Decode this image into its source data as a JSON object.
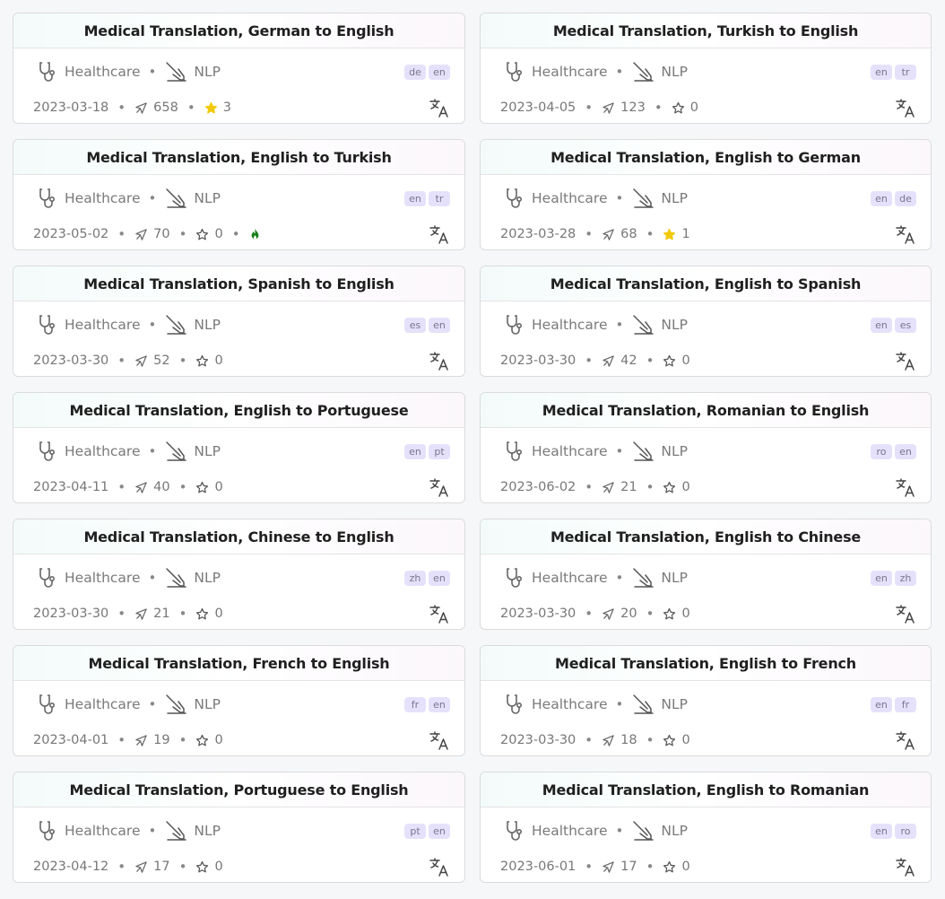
{
  "colors": {
    "star_filled": "#f2c90a",
    "flame": "#1a7f1a",
    "lang_badge_bg": "#e6e1fa",
    "lang_badge_fg": "#7a7690"
  },
  "icons": {
    "category": "stethoscope-icon",
    "type": "cpu-icon",
    "downloads": "pin-icon",
    "stars": "star-icon",
    "trending": "flame-icon",
    "task": "translate-icon"
  },
  "cards": [
    {
      "title": "Medical Translation, German to English",
      "category": "Healthcare",
      "type": "NLP",
      "langs": [
        "de",
        "en"
      ],
      "date": "2023-03-18",
      "downloads": "658",
      "stars": "3",
      "starred": true,
      "trending": false
    },
    {
      "title": "Medical Translation, Turkish to English",
      "category": "Healthcare",
      "type": "NLP",
      "langs": [
        "en",
        "tr"
      ],
      "date": "2023-04-05",
      "downloads": "123",
      "stars": "0",
      "starred": false,
      "trending": false
    },
    {
      "title": "Medical Translation, English to Turkish",
      "category": "Healthcare",
      "type": "NLP",
      "langs": [
        "en",
        "tr"
      ],
      "date": "2023-05-02",
      "downloads": "70",
      "stars": "0",
      "starred": false,
      "trending": true
    },
    {
      "title": "Medical Translation, English to German",
      "category": "Healthcare",
      "type": "NLP",
      "langs": [
        "en",
        "de"
      ],
      "date": "2023-03-28",
      "downloads": "68",
      "stars": "1",
      "starred": true,
      "trending": false
    },
    {
      "title": "Medical Translation, Spanish to English",
      "category": "Healthcare",
      "type": "NLP",
      "langs": [
        "es",
        "en"
      ],
      "date": "2023-03-30",
      "downloads": "52",
      "stars": "0",
      "starred": false,
      "trending": false
    },
    {
      "title": "Medical Translation, English to Spanish",
      "category": "Healthcare",
      "type": "NLP",
      "langs": [
        "en",
        "es"
      ],
      "date": "2023-03-30",
      "downloads": "42",
      "stars": "0",
      "starred": false,
      "trending": false
    },
    {
      "title": "Medical Translation, English to Portuguese",
      "category": "Healthcare",
      "type": "NLP",
      "langs": [
        "en",
        "pt"
      ],
      "date": "2023-04-11",
      "downloads": "40",
      "stars": "0",
      "starred": false,
      "trending": false
    },
    {
      "title": "Medical Translation, Romanian to English",
      "category": "Healthcare",
      "type": "NLP",
      "langs": [
        "ro",
        "en"
      ],
      "date": "2023-06-02",
      "downloads": "21",
      "stars": "0",
      "starred": false,
      "trending": false
    },
    {
      "title": "Medical Translation, Chinese to English",
      "category": "Healthcare",
      "type": "NLP",
      "langs": [
        "zh",
        "en"
      ],
      "date": "2023-03-30",
      "downloads": "21",
      "stars": "0",
      "starred": false,
      "trending": false
    },
    {
      "title": "Medical Translation, English to Chinese",
      "category": "Healthcare",
      "type": "NLP",
      "langs": [
        "en",
        "zh"
      ],
      "date": "2023-03-30",
      "downloads": "20",
      "stars": "0",
      "starred": false,
      "trending": false
    },
    {
      "title": "Medical Translation, French to English",
      "category": "Healthcare",
      "type": "NLP",
      "langs": [
        "fr",
        "en"
      ],
      "date": "2023-04-01",
      "downloads": "19",
      "stars": "0",
      "starred": false,
      "trending": false
    },
    {
      "title": "Medical Translation, English to French",
      "category": "Healthcare",
      "type": "NLP",
      "langs": [
        "en",
        "fr"
      ],
      "date": "2023-03-30",
      "downloads": "18",
      "stars": "0",
      "starred": false,
      "trending": false
    },
    {
      "title": "Medical Translation, Portuguese to English",
      "category": "Healthcare",
      "type": "NLP",
      "langs": [
        "pt",
        "en"
      ],
      "date": "2023-04-12",
      "downloads": "17",
      "stars": "0",
      "starred": false,
      "trending": false
    },
    {
      "title": "Medical Translation, English to Romanian",
      "category": "Healthcare",
      "type": "NLP",
      "langs": [
        "en",
        "ro"
      ],
      "date": "2023-06-01",
      "downloads": "17",
      "stars": "0",
      "starred": false,
      "trending": false
    }
  ]
}
